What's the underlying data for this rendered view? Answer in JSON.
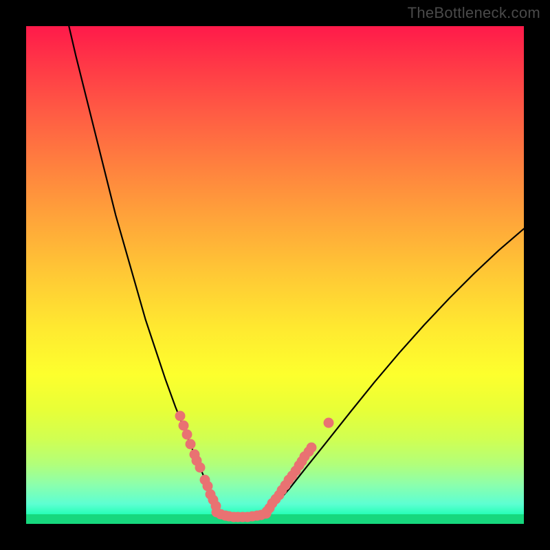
{
  "watermark": "TheBottleneck.com",
  "chart_data": {
    "type": "line",
    "title": "",
    "xlabel": "",
    "ylabel": "",
    "xlim": [
      0,
      100
    ],
    "ylim": [
      0,
      100
    ],
    "series": [
      {
        "name": "left-curve",
        "x": [
          8.6,
          10.0,
          12.0,
          14.0,
          16.0,
          18.0,
          20.0,
          22.0,
          24.0,
          26.0,
          28.0,
          30.0,
          32.0,
          34.0,
          35.5,
          37.0,
          38.2
        ],
        "y": [
          100,
          94,
          86,
          78,
          70,
          62,
          55,
          48,
          41,
          35,
          29,
          23.5,
          18.5,
          13.5,
          10,
          6,
          2.3
        ]
      },
      {
        "name": "flat-min",
        "x": [
          38.2,
          40.0,
          42.0,
          44.0,
          46.0,
          48.0
        ],
        "y": [
          2.3,
          1.6,
          1.4,
          1.4,
          1.6,
          2.0
        ]
      },
      {
        "name": "right-curve",
        "x": [
          48.0,
          50.0,
          53.0,
          56.0,
          60.0,
          65.0,
          70.0,
          75.0,
          80.0,
          85.0,
          90.0,
          95.0,
          100.0
        ],
        "y": [
          2.0,
          3.8,
          7.2,
          11.0,
          16.0,
          22.3,
          28.5,
          34.4,
          40.0,
          45.3,
          50.3,
          55.0,
          59.3
        ]
      }
    ],
    "dots_left": {
      "name": "left-markers",
      "color": "#e97272",
      "points": [
        {
          "x": 30.9,
          "y": 21.7
        },
        {
          "x": 31.6,
          "y": 19.7
        },
        {
          "x": 32.3,
          "y": 18.0
        },
        {
          "x": 33.0,
          "y": 16.0
        },
        {
          "x": 33.8,
          "y": 14.0
        },
        {
          "x": 34.3,
          "y": 12.7
        },
        {
          "x": 34.9,
          "y": 11.3
        },
        {
          "x": 35.9,
          "y": 8.8
        },
        {
          "x": 36.4,
          "y": 7.6
        },
        {
          "x": 37.0,
          "y": 5.9
        },
        {
          "x": 37.5,
          "y": 4.8
        },
        {
          "x": 38.1,
          "y": 3.6
        }
      ]
    },
    "dots_bottom": {
      "name": "bottom-markers",
      "color": "#e97272",
      "points": [
        {
          "x": 38.2,
          "y": 2.4
        },
        {
          "x": 39.1,
          "y": 2.0
        },
        {
          "x": 40.0,
          "y": 1.6
        },
        {
          "x": 40.8,
          "y": 1.5
        },
        {
          "x": 41.7,
          "y": 1.4
        },
        {
          "x": 42.6,
          "y": 1.4
        },
        {
          "x": 43.5,
          "y": 1.4
        },
        {
          "x": 44.5,
          "y": 1.4
        },
        {
          "x": 45.5,
          "y": 1.5
        },
        {
          "x": 46.4,
          "y": 1.6
        },
        {
          "x": 47.3,
          "y": 1.8
        },
        {
          "x": 48.2,
          "y": 2.1
        }
      ]
    },
    "dots_right": {
      "name": "right-markers",
      "color": "#e97272",
      "points": [
        {
          "x": 48.3,
          "y": 2.5
        },
        {
          "x": 48.9,
          "y": 3.2
        },
        {
          "x": 49.5,
          "y": 4.1
        },
        {
          "x": 50.1,
          "y": 5.0
        },
        {
          "x": 50.8,
          "y": 5.8
        },
        {
          "x": 51.4,
          "y": 6.8
        },
        {
          "x": 52.1,
          "y": 7.8
        },
        {
          "x": 52.8,
          "y": 8.8
        },
        {
          "x": 53.4,
          "y": 9.7
        },
        {
          "x": 54.2,
          "y": 10.7
        },
        {
          "x": 54.8,
          "y": 11.7
        },
        {
          "x": 55.4,
          "y": 12.6
        },
        {
          "x": 56.0,
          "y": 13.5
        },
        {
          "x": 56.7,
          "y": 14.5
        },
        {
          "x": 57.3,
          "y": 15.4
        },
        {
          "x": 60.8,
          "y": 20.3
        }
      ]
    },
    "background_gradient": {
      "top": "#ff1a4a",
      "mid": "#ffea30",
      "bottom": "#13f58e"
    }
  }
}
